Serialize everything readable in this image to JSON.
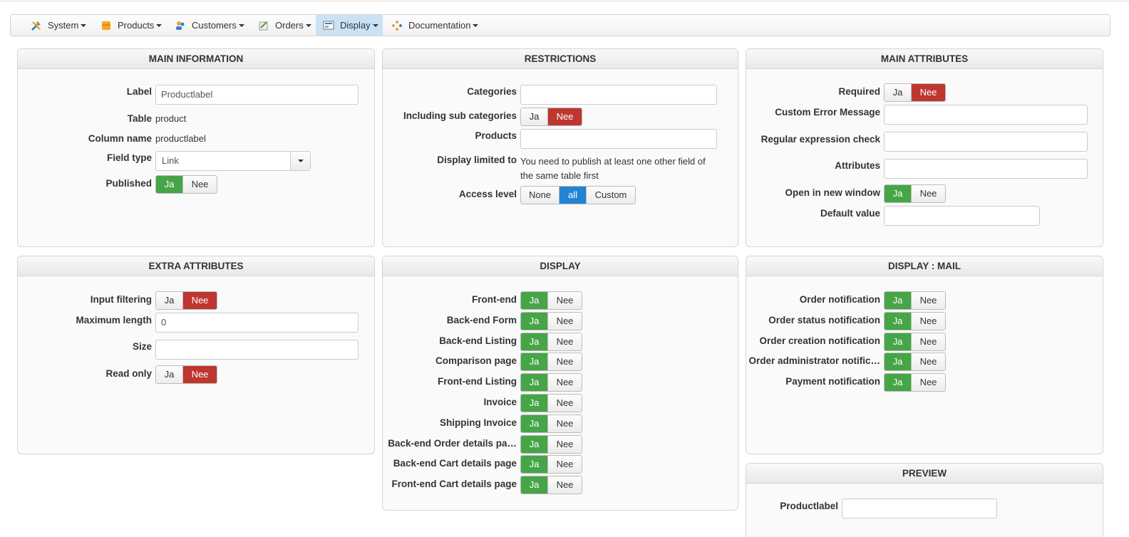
{
  "menu": {
    "items": [
      {
        "label": "System",
        "icon": "tools-icon"
      },
      {
        "label": "Products",
        "icon": "box-icon"
      },
      {
        "label": "Customers",
        "icon": "users-icon"
      },
      {
        "label": "Orders",
        "icon": "orders-icon"
      },
      {
        "label": "Display",
        "icon": "display-icon"
      },
      {
        "label": "Documentation",
        "icon": "doc-icon"
      }
    ]
  },
  "main_information": {
    "title": "MAIN INFORMATION",
    "label_label": "Label",
    "label_value": "Productlabel",
    "table_label": "Table",
    "table_value": "product",
    "column_label": "Column name",
    "column_value": "productlabel",
    "fieldtype_label": "Field type",
    "fieldtype_value": "Link",
    "published_label": "Published"
  },
  "restrictions": {
    "title": "RESTRICTIONS",
    "categories_label": "Categories",
    "subcat_label": "Including sub categories",
    "products_label": "Products",
    "limited_label": "Display limited to",
    "limited_text_1": "You need to publish at least one other field of",
    "limited_text_2": "the same table first",
    "access_label": "Access level",
    "access_none": "None",
    "access_all": "all",
    "access_custom": "Custom"
  },
  "main_attributes": {
    "title": "MAIN ATTRIBUTES",
    "required_label": "Required",
    "error_label": "Custom Error Message",
    "regex_label": "Regular expression check",
    "attributes_label": "Attributes",
    "newwindow_label": "Open in new window",
    "default_label": "Default value"
  },
  "extra_attributes": {
    "title": "EXTRA ATTRIBUTES",
    "filtering_label": "Input filtering",
    "maxlen_label": "Maximum length",
    "maxlen_value": "0",
    "size_label": "Size",
    "readonly_label": "Read only"
  },
  "display": {
    "title": "DISPLAY",
    "rows": [
      "Front-end",
      "Back-end Form",
      "Back-end Listing",
      "Comparison page",
      "Front-end Listing",
      "Invoice",
      "Shipping Invoice",
      "Back-end Order details pa…",
      "Back-end Cart details page",
      "Front-end Cart details page"
    ]
  },
  "display_mail": {
    "title": "DISPLAY : MAIL",
    "rows": [
      "Order notification",
      "Order status notification",
      "Order creation notification",
      "Order administrator notific…",
      "Payment notification"
    ]
  },
  "preview": {
    "title": "PREVIEW",
    "field_label": "Productlabel"
  },
  "toggle": {
    "yes": "Ja",
    "no": "Nee"
  },
  "colors": {
    "green": "#46a546",
    "red": "#bd362f",
    "blue": "#2384d3",
    "menu_active": "#cbe2f5"
  }
}
